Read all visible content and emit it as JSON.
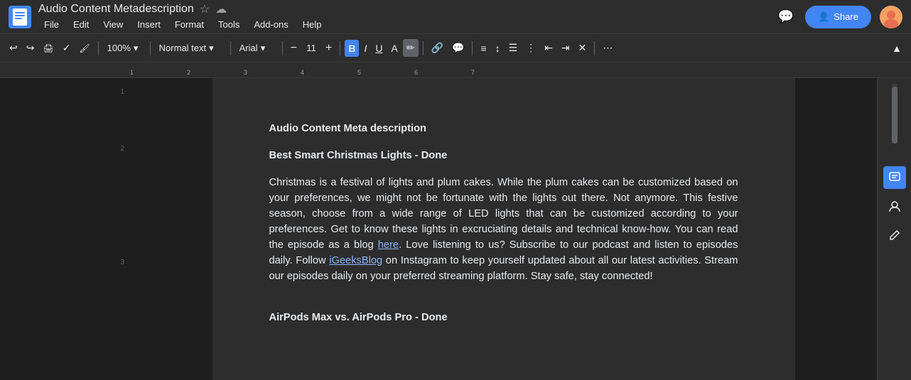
{
  "app": {
    "title": "Audio Content Metadescription",
    "doc_icon_color": "#4285f4"
  },
  "menu": {
    "items": [
      "File",
      "Edit",
      "View",
      "Insert",
      "Format",
      "Tools",
      "Add-ons",
      "Help"
    ]
  },
  "toolbar": {
    "zoom": "100%",
    "style": "Normal text",
    "font": "Arial",
    "font_size": "11",
    "share_label": "Share"
  },
  "document": {
    "heading": "Audio Content Meta description",
    "subheading1": "Best Smart Christmas Lights - Done",
    "paragraph1_part1": "Christmas is a festival of lights and plum cakes. While the plum cakes can be customized based on your preferences, we might not be fortunate with the lights out there. Not anymore. This festive season, choose from a wide range of LED lights that can be customized according to your preferences. Get to know these lights in excruciating details and technical know-how. You can read the episode as a blog ",
    "paragraph1_link": "here",
    "paragraph1_part2": ". Love listening to us? Subscribe to our podcast and listen to episodes daily. Follow ",
    "paragraph1_link2": "iGeeksBlog",
    "paragraph1_part3": " on Instagram to keep yourself updated about all our latest activities. Stream our episodes daily on your preferred streaming platform. Stay safe, stay connected!",
    "subheading2": "AirPods Max vs. AirPods Pro - Done"
  }
}
